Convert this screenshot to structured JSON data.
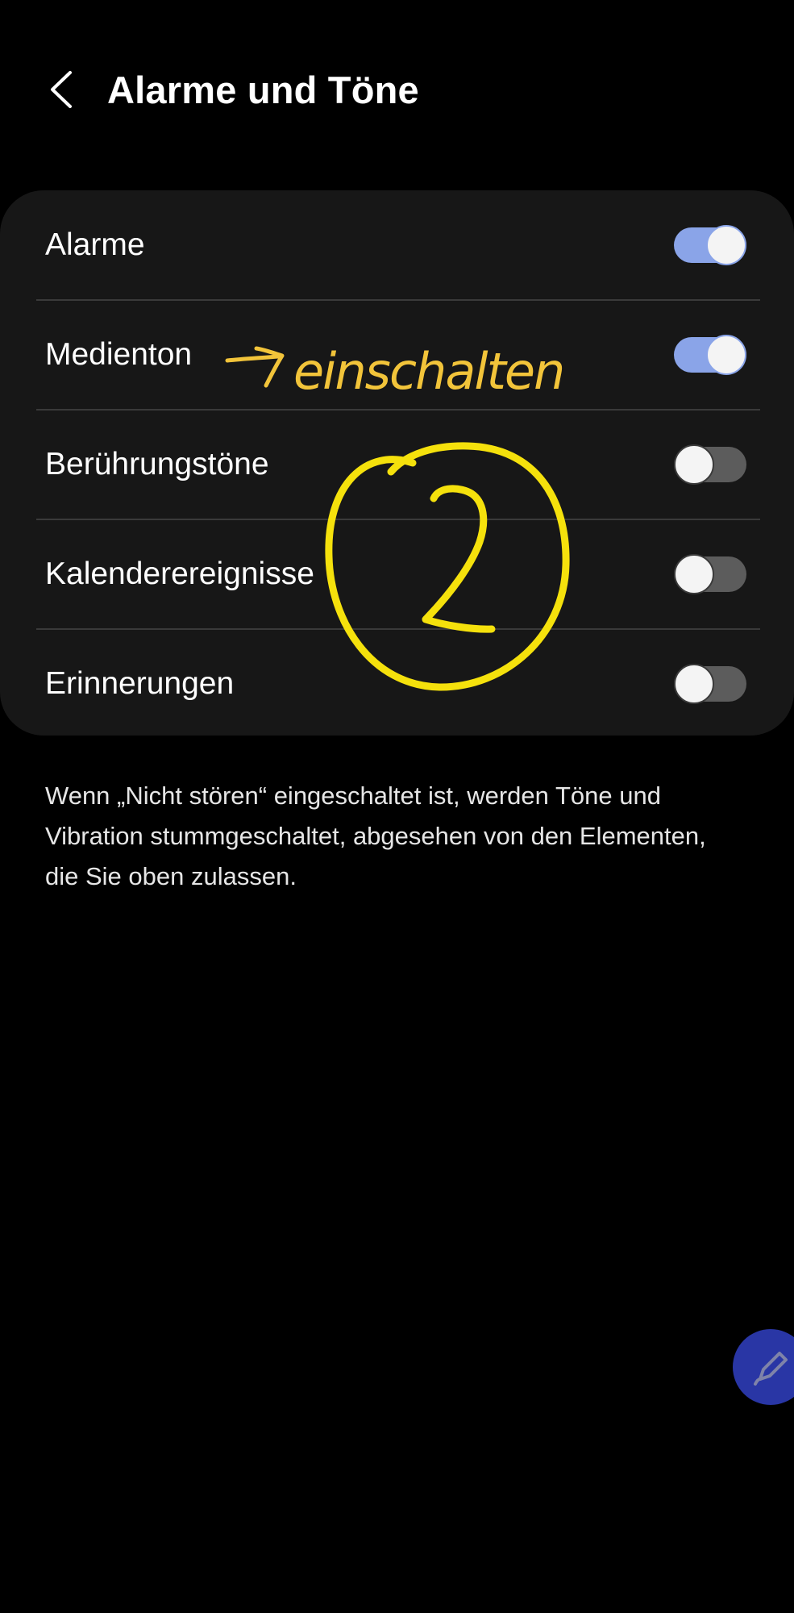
{
  "header": {
    "title": "Alarme und Töne",
    "back_icon": "chevron-left-icon"
  },
  "settings": [
    {
      "label": "Alarme",
      "enabled": true
    },
    {
      "label": "Medienton",
      "enabled": true
    },
    {
      "label": "Berührungstöne",
      "enabled": false
    },
    {
      "label": "Kalenderereignisse",
      "enabled": false
    },
    {
      "label": "Erinnerungen",
      "enabled": false
    }
  ],
  "description": "Wenn „Nicht stören“ eingeschaltet ist, werden Töne und Vibration stummgeschaltet, abgesehen von den Elementen, die Sie oben zulassen.",
  "annotations": {
    "handwritten_note": "→ einschalten",
    "step_number": "2",
    "note_color": "#f2c43a",
    "circle_color": "#f5e10c"
  },
  "fab": {
    "icon": "pen-edit-icon",
    "color": "#2d3bb3"
  },
  "colors": {
    "background": "#000000",
    "card": "#171717",
    "toggle_on": "#8aa4e8",
    "toggle_off": "#5c5c5c"
  }
}
